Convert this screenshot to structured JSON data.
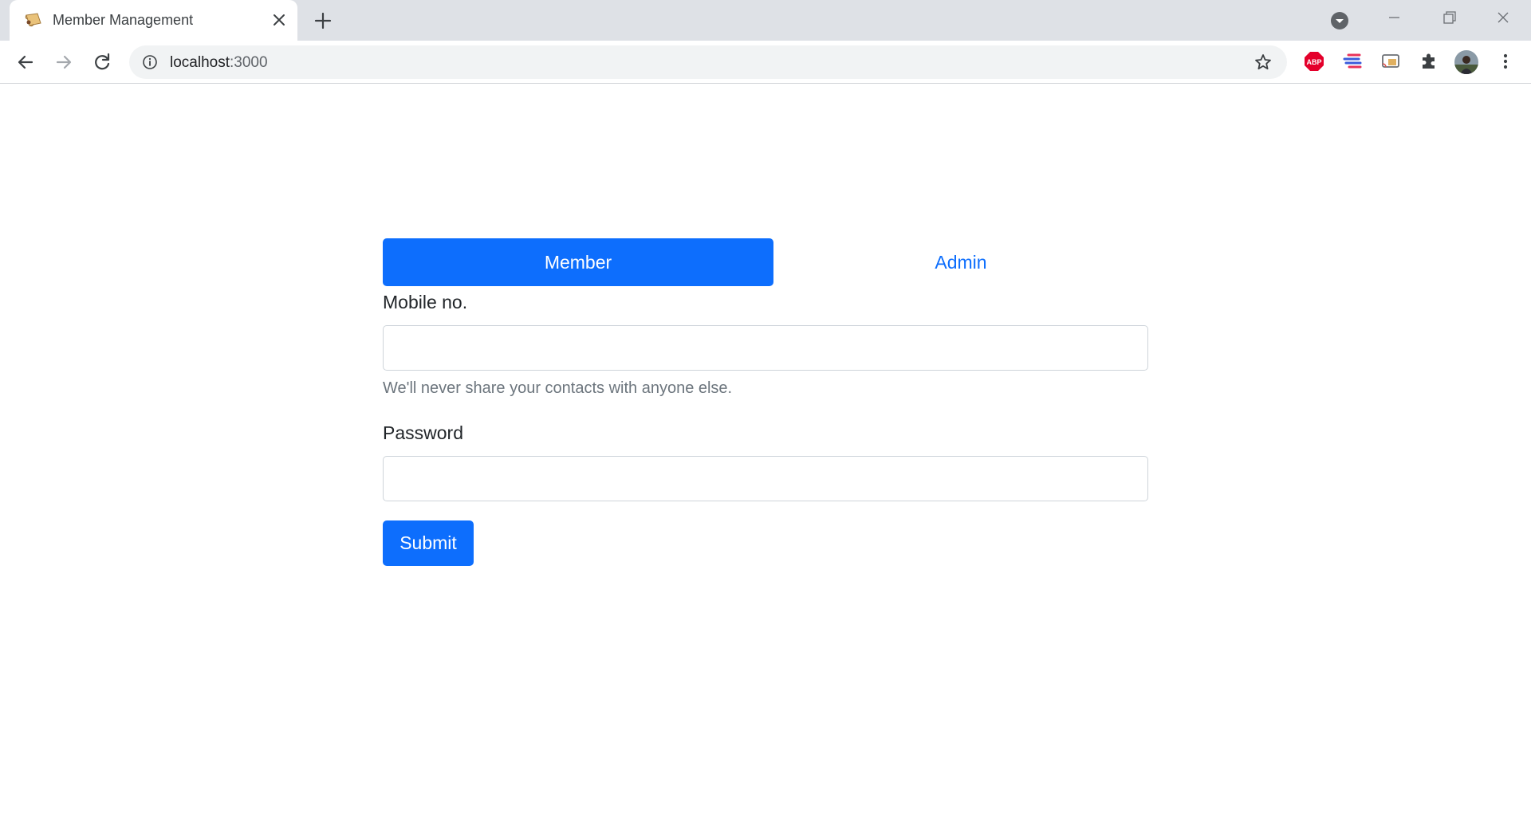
{
  "browser": {
    "tab": {
      "title": "Member Management"
    },
    "address": {
      "host": "localhost",
      "port": ":3000"
    },
    "icons": {
      "favicon": "scroll-icon",
      "tab_close": "close-icon",
      "new_tab": "plus-icon",
      "back": "arrow-left-icon",
      "forward": "arrow-right-icon",
      "reload": "reload-icon",
      "site_info": "info-icon",
      "bookmark": "star-icon",
      "extensions": "puzzle-icon",
      "menu": "kebab-menu-icon"
    },
    "extensions": {
      "abp_label": "ABP"
    }
  },
  "form": {
    "tabs": [
      {
        "label": "Member",
        "active": true
      },
      {
        "label": "Admin",
        "active": false
      }
    ],
    "mobile": {
      "label": "Mobile no.",
      "value": "",
      "help": "We'll never share your contacts with anyone else."
    },
    "password": {
      "label": "Password",
      "value": ""
    },
    "submit_label": "Submit"
  },
  "colors": {
    "primary": "#0d6efd",
    "text": "#212529",
    "muted": "#6c757d",
    "border": "#ced4da"
  }
}
